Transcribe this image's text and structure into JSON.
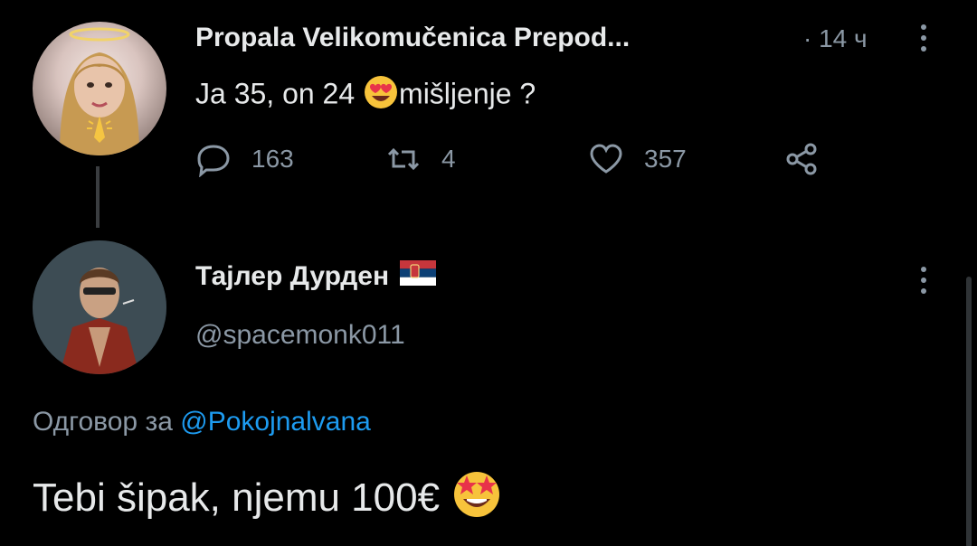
{
  "tweet1": {
    "author_name": "Propala Velikomučenica Prepod...",
    "time": "· 14 ч",
    "text_before_emoji": "Ja 35, on 24 ",
    "emoji": "heart-eyes-emoji",
    "text_after_emoji": "mišljenje ?",
    "reply_count": "163",
    "retweet_count": "4",
    "like_count": "357"
  },
  "tweet2": {
    "author_name": "Тајлер Дурден",
    "flag": "serbia-flag-icon",
    "handle": "@spacemonk011",
    "reply_prefix": "Одговор за ",
    "reply_mention": "@Pokojnalvana",
    "text": "Tebi šipak, njemu 100€",
    "emoji": "star-struck-emoji"
  },
  "colors": {
    "background": "#000000",
    "text": "#e7e9ea",
    "muted": "#8b98a5",
    "link": "#1d9bf0"
  }
}
